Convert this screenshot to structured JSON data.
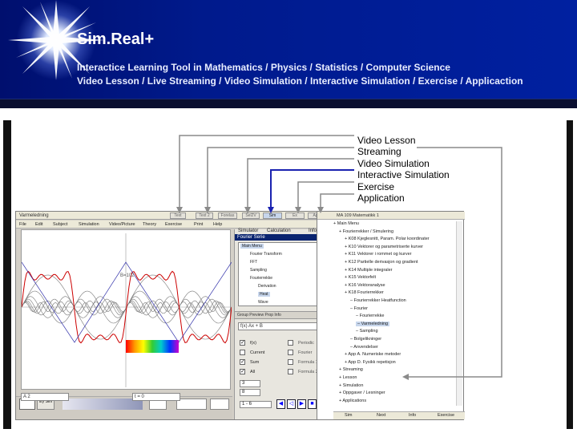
{
  "header": {
    "title": "Sim.Real+",
    "subtitle_1": "Interactice Learning Tool in Mathematics / Physics / Statistics / Computer Science",
    "subtitle_2": "Video Lesson  /  Live Streaming  /  Video Simulation  /  Interactive Simulation  /  Exercise  /  Applicaction"
  },
  "callouts": [
    "Video Lesson",
    "Streaming",
    "Video Simulation",
    "Interactive Simulation",
    "Exercise",
    "Application"
  ],
  "app": {
    "title": "Varmeledning",
    "tabs": [
      "Text",
      "Text 2",
      "Forelas",
      "Sel2V",
      "Sim",
      "Ex",
      "App"
    ],
    "active_tab": "Sim",
    "menu": [
      "File",
      "Edit",
      "Subject",
      "Simulation",
      "Video/Picture",
      "Theory",
      "Exercise",
      "Print",
      "Help"
    ],
    "plot_label": "B=102",
    "field_left": "A   2",
    "field_right": "t = 0",
    "ctrl_btn": "x/y Sim",
    "mid": {
      "options": [
        "Simulator",
        "Calculation",
        "Info"
      ],
      "panel_title": "Fourier Serie",
      "tree": [
        "Main Menu",
        "Fourier Transform",
        "FFT",
        "Sampling",
        "Fourierrekke",
        "Derivation",
        "Heat",
        "Wave"
      ],
      "tree_selected": "Heat",
      "bar": "Group  Preview  Prop  Info",
      "fx": "f(x)     Ax + B",
      "checks": [
        {
          "label": "f(x)",
          "checked": true
        },
        {
          "label": "Current",
          "checked": false
        },
        {
          "label": "Sum",
          "checked": true
        },
        {
          "label": "All",
          "checked": true
        }
      ],
      "checks_right": [
        "Periodic",
        "Fourier",
        "Formula 1/x",
        "Formula 2x"
      ],
      "n1": "3",
      "n2": "8",
      "n3": "1 - 6"
    },
    "right": {
      "title": "MA 109  Matematikk 1",
      "tree": [
        "Main Menu",
        "Fourierrekker / Simulering",
        "K08 Kjeglesnitt, Param. Polar koordinater",
        "K10 Vektorer og parametriserte kurver",
        "K11 Vektorer i rommet og kurver",
        "K12 Partielle derivasjon og gradient",
        "K14 Multiple integraler",
        "K15 Vektorfelt",
        "K16 Vektoranalyse",
        "K18 Fourierrekker",
        "Fourierrekker Heatfunction",
        "Fourier",
        "Fourierrekke",
        "Varmeledning",
        "Sampling",
        "Bolgelikninger",
        "Anvendelser",
        "App A. Numeriske metoder",
        "App D. Fysikk repetisjon",
        "Streaming",
        "Lesson",
        "Simulation",
        "Oppgaver / Lesninger",
        "Applications"
      ],
      "tree_selected": "Varmeledning",
      "buttons": [
        "Sim",
        "Next",
        "Info",
        "Exercise"
      ]
    }
  }
}
